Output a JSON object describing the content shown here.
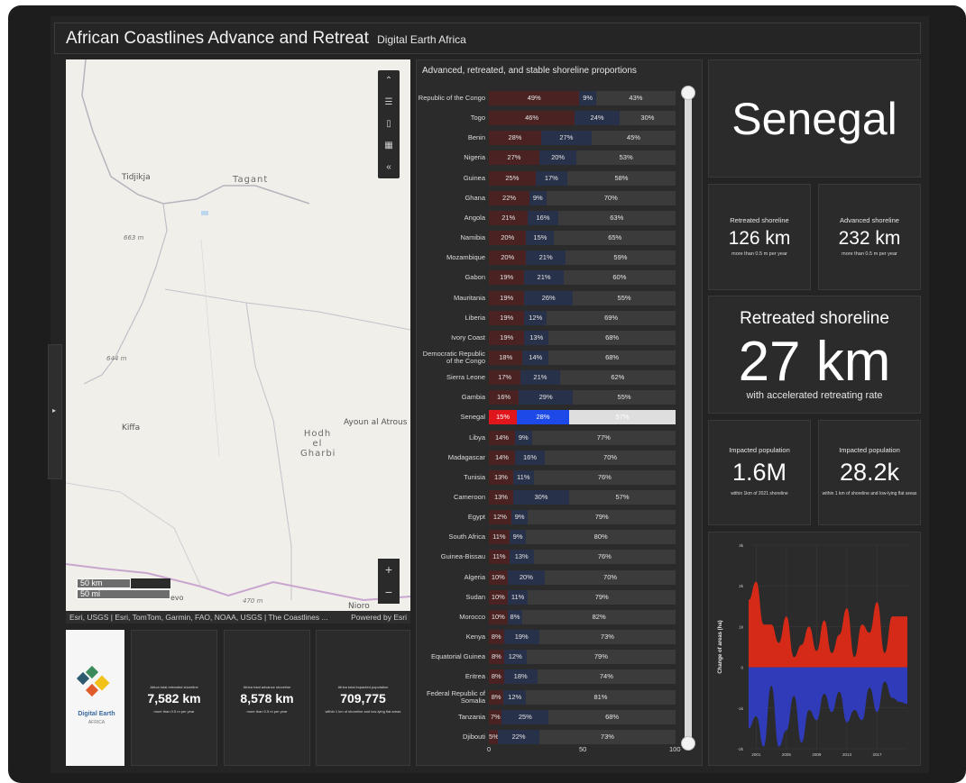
{
  "header": {
    "title": "African Coastlines Advance and Retreat",
    "subtitle": "Digital Earth Africa"
  },
  "map": {
    "places": [
      "Tidjikja",
      "Tagant",
      "Kiffa",
      "Hodh el Gharbi",
      "Ayoun al Atrous",
      "Nioro"
    ],
    "elevations": [
      "663 m",
      "644 m",
      "470 m"
    ],
    "extra_label": "evo",
    "tools": [
      "collapse-icon",
      "legend-icon",
      "bookmark-icon",
      "qr-icon",
      "chevron-left-icon"
    ],
    "scale_km": "50 km",
    "scale_mi": "50 mi",
    "attribution": "Esri, USGS | Esri, TomTom, Garmin, FAO, NOAA, USGS | The Coastlines ...",
    "powered_by": "Powered by Esri",
    "zoom_in": "+",
    "zoom_out": "−"
  },
  "logo": {
    "name": "Digital Earth",
    "sub": "AFRICA"
  },
  "africa_stats": [
    {
      "caption": "Africa total retreated shoreline",
      "value": "7,582 km",
      "sub": "more than 0.5 m per year"
    },
    {
      "caption": "Africa total advance shoreline",
      "value": "8,578 km",
      "sub": "more than 0.5 m per year"
    },
    {
      "caption": "Africa total impacted population",
      "value": "709,775",
      "sub": "within 1 km of shoreline and low-lying flat areas"
    }
  ],
  "bar_chart": {
    "title": "Advanced, retreated, and stable shoreline proportions",
    "axis": [
      "0",
      "50",
      "100"
    ],
    "colors": {
      "retreat": "#4a2222",
      "advance": "#28314a",
      "stable": "#3b3b3b",
      "hl_retreat": "#e0161c",
      "hl_advance": "#1c49e8",
      "hl_stable": "#dedede"
    },
    "rows": [
      {
        "country": "Republic of the Congo",
        "r": 49,
        "a": 9,
        "s": 43
      },
      {
        "country": "Togo",
        "r": 46,
        "a": 24,
        "s": 30
      },
      {
        "country": "Benin",
        "r": 28,
        "a": 27,
        "s": 45
      },
      {
        "country": "Nigeria",
        "r": 27,
        "a": 20,
        "s": 53
      },
      {
        "country": "Guinea",
        "r": 25,
        "a": 17,
        "s": 58
      },
      {
        "country": "Ghana",
        "r": 22,
        "a": 9,
        "s": 70
      },
      {
        "country": "Angola",
        "r": 21,
        "a": 16,
        "s": 63
      },
      {
        "country": "Namibia",
        "r": 20,
        "a": 15,
        "s": 65
      },
      {
        "country": "Mozambique",
        "r": 20,
        "a": 21,
        "s": 59
      },
      {
        "country": "Gabon",
        "r": 19,
        "a": 21,
        "s": 60
      },
      {
        "country": "Mauritania",
        "r": 19,
        "a": 26,
        "s": 55
      },
      {
        "country": "Liberia",
        "r": 19,
        "a": 12,
        "s": 69
      },
      {
        "country": "Ivory Coast",
        "r": 19,
        "a": 13,
        "s": 68
      },
      {
        "country": "Democratic Republic of the Congo",
        "r": 18,
        "a": 14,
        "s": 68
      },
      {
        "country": "Sierra Leone",
        "r": 17,
        "a": 21,
        "s": 62
      },
      {
        "country": "Gambia",
        "r": 16,
        "a": 29,
        "s": 55
      },
      {
        "country": "Senegal",
        "r": 15,
        "a": 28,
        "s": 57,
        "highlight": true
      },
      {
        "country": "Libya",
        "r": 14,
        "a": 9,
        "s": 77
      },
      {
        "country": "Madagascar",
        "r": 14,
        "a": 16,
        "s": 70
      },
      {
        "country": "Tunisia",
        "r": 13,
        "a": 11,
        "s": 76
      },
      {
        "country": "Cameroon",
        "r": 13,
        "a": 30,
        "s": 57
      },
      {
        "country": "Egypt",
        "r": 12,
        "a": 9,
        "s": 79
      },
      {
        "country": "South Africa",
        "r": 11,
        "a": 9,
        "s": 80
      },
      {
        "country": "Guinea-Bissau",
        "r": 11,
        "a": 13,
        "s": 76
      },
      {
        "country": "Algeria",
        "r": 10,
        "a": 20,
        "s": 70
      },
      {
        "country": "Sudan",
        "r": 10,
        "a": 11,
        "s": 79
      },
      {
        "country": "Morocco",
        "r": 10,
        "a": 8,
        "s": 82
      },
      {
        "country": "Kenya",
        "r": 8,
        "a": 19,
        "s": 73
      },
      {
        "country": "Equatorial Guinea",
        "r": 8,
        "a": 12,
        "s": 79
      },
      {
        "country": "Eritrea",
        "r": 8,
        "a": 18,
        "s": 74
      },
      {
        "country": "Federal Republic of Somalia",
        "r": 8,
        "a": 12,
        "s": 81
      },
      {
        "country": "Tanzania",
        "r": 7,
        "a": 25,
        "s": 68
      },
      {
        "country": "Djibouti",
        "r": 5,
        "a": 22,
        "s": 73
      }
    ]
  },
  "country": "Senegal",
  "kpis": {
    "retreated": {
      "caption": "Retreated shoreline",
      "value": "126 km",
      "sub": "more than 0.5 m per year"
    },
    "advanced": {
      "caption": "Advanced shoreline",
      "value": "232 km",
      "sub": "more than 0.5 m per year"
    },
    "accelerated": {
      "caption": "Retreated shoreline",
      "value": "27 km",
      "sub": "with accelerated retreating rate"
    },
    "pop_2021": {
      "caption": "Impacted population",
      "value": "1.6M",
      "sub": "within 1km of 2021 shoreline"
    },
    "pop_lowlying": {
      "caption": "Impacted population",
      "value": "28.2k",
      "sub": "within 1 km of shoreline and low-lying flat areas"
    }
  },
  "chart_data": {
    "type": "area",
    "title": "",
    "xlabel": "",
    "ylabel": "Change of areas (ha)",
    "x_ticks": [
      "2001",
      "2005",
      "2009",
      "2013",
      "2017"
    ],
    "y_ticks": [
      "3k",
      "2k",
      "1k",
      "0",
      "-1k",
      "-2k"
    ],
    "ylim": [
      -2000,
      3000
    ],
    "xlim": [
      2000,
      2021
    ],
    "colors": {
      "advance": "#d42a17",
      "retreat": "#2f3bb8"
    },
    "x": [
      2000,
      2001,
      2002,
      2003,
      2004,
      2005,
      2006,
      2007,
      2008,
      2009,
      2010,
      2011,
      2012,
      2013,
      2014,
      2015,
      2016,
      2017,
      2018,
      2019,
      2020,
      2021
    ],
    "series": [
      {
        "values": [
          1650,
          2100,
          1050,
          1050,
          600,
          1250,
          250,
          550,
          1000,
          400,
          1150,
          350,
          800,
          1450,
          250,
          1050,
          850,
          1600,
          350,
          1250,
          1250,
          1250
        ]
      },
      {
        "values": [
          -1500,
          -1200,
          -1950,
          -450,
          -1950,
          -1550,
          -700,
          -1850,
          -1050,
          -1300,
          -650,
          -1100,
          -600,
          -1350,
          -1050,
          -1300,
          -500,
          -1100,
          -350,
          -750,
          -850,
          -900
        ]
      }
    ]
  }
}
